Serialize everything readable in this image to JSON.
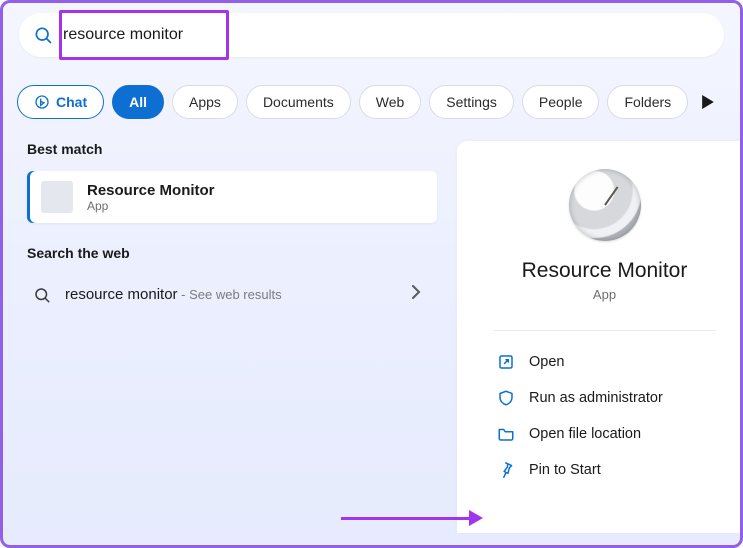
{
  "search": {
    "value": "resource monitor",
    "placeholder": ""
  },
  "filters": {
    "chat": "Chat",
    "all": "All",
    "apps": "Apps",
    "documents": "Documents",
    "web": "Web",
    "settings": "Settings",
    "people": "People",
    "folders": "Folders"
  },
  "sections": {
    "best_match": "Best match",
    "search_web": "Search the web"
  },
  "best_match_item": {
    "title": "Resource Monitor",
    "subtitle": "App"
  },
  "web_item": {
    "query": "resource monitor",
    "hint": " - See web results"
  },
  "detail": {
    "title": "Resource Monitor",
    "type": "App"
  },
  "actions": {
    "open": "Open",
    "admin": "Run as administrator",
    "location": "Open file location",
    "pin_start": "Pin to Start"
  },
  "colors": {
    "accent": "#0d6fd1",
    "annotation": "#a234ec"
  }
}
